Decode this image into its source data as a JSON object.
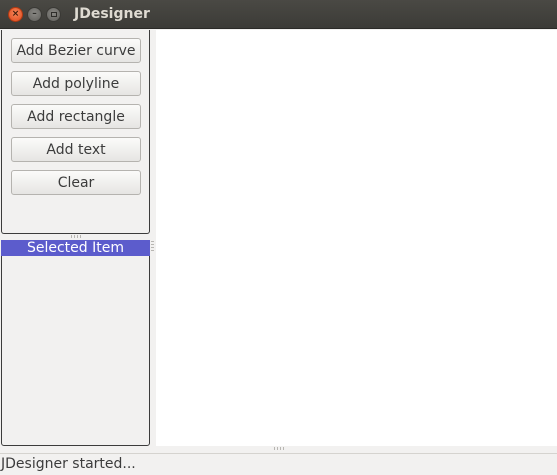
{
  "window": {
    "title": "JDesigner",
    "close_glyph": "×",
    "min_glyph": "–"
  },
  "toolbar": {
    "buttons": [
      {
        "label": "Add Bezier curve"
      },
      {
        "label": "Add polyline"
      },
      {
        "label": "Add rectangle"
      },
      {
        "label": "Add text"
      },
      {
        "label": "Clear"
      }
    ]
  },
  "selected_item": {
    "header": "Selected Item"
  },
  "status": {
    "text": "JDesigner started..."
  },
  "colors": {
    "titlebar": "#3c3b37",
    "close_button": "#e0481c",
    "selected_header": "#5c5ccc",
    "canvas": "#ffffff"
  },
  "icons": [
    "close-icon",
    "minimize-icon",
    "maximize-icon"
  ]
}
